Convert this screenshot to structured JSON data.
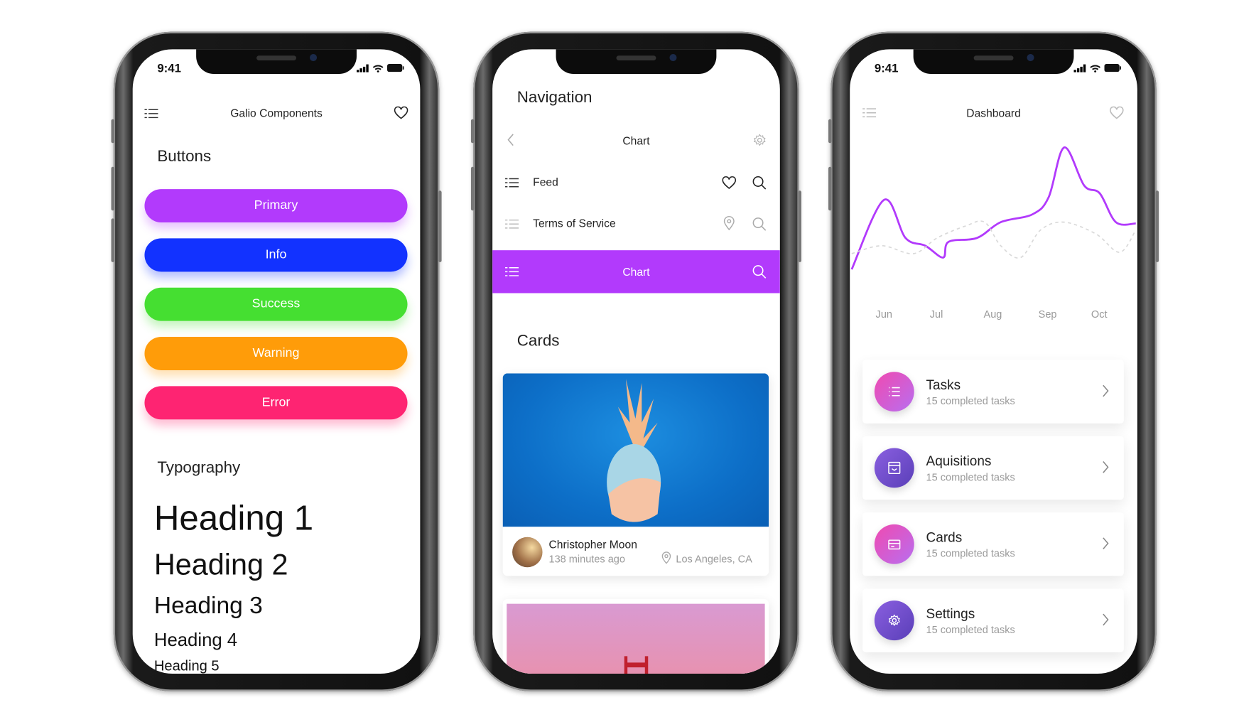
{
  "colors": {
    "primary": "#B23AFC",
    "info": "#1232FF",
    "success": "#45DF31",
    "warning": "#FF9C09",
    "error": "#FE2472",
    "chart_line": "#B23AFC",
    "chart_dash": "#D9D9D9"
  },
  "phone1": {
    "status": {
      "time": "9:41"
    },
    "header": {
      "title": "Galio Components",
      "left_icon": "menu-icon",
      "right_icon": "heart-icon"
    },
    "buttons_title": "Buttons",
    "buttons": [
      {
        "label": "Primary",
        "color": "#B23AFC"
      },
      {
        "label": "Info",
        "color": "#1232FF"
      },
      {
        "label": "Success",
        "color": "#45DF31"
      },
      {
        "label": "Warning",
        "color": "#FF9C09"
      },
      {
        "label": "Error",
        "color": "#FE2472"
      }
    ],
    "typography_title": "Typography",
    "headings": [
      "Heading 1",
      "Heading 2",
      "Heading 3",
      "Heading 4",
      "Heading 5"
    ]
  },
  "phone2": {
    "title": "Navigation",
    "navbars": [
      {
        "title": "Chart",
        "left_icon": "chevron-left-icon",
        "right_icon": "gear-icon"
      },
      {
        "title": "Feed",
        "icons": [
          "menu-icon",
          "heart-icon",
          "search-icon"
        ]
      },
      {
        "title": "Terms of Service",
        "icons": [
          "menu-icon",
          "map-pin-icon",
          "search-icon"
        ]
      },
      {
        "title": "Chart",
        "icons": [
          "menu-icon",
          "search-icon"
        ]
      }
    ],
    "cards_title": "Cards",
    "card": {
      "author": "Christopher Moon",
      "time": "138 minutes ago",
      "location": "Los Angeles, CA"
    }
  },
  "phone3": {
    "status": {
      "time": "9:41"
    },
    "header": {
      "title": "Dashboard"
    },
    "items": [
      {
        "title": "Tasks",
        "subtitle": "15 completed tasks",
        "icon": "list-icon"
      },
      {
        "title": "Aquisitions",
        "subtitle": "15 completed tasks",
        "icon": "archive-icon"
      },
      {
        "title": "Cards",
        "subtitle": "15 completed tasks",
        "icon": "credit-card-icon"
      },
      {
        "title": "Settings",
        "subtitle": "15 completed tasks",
        "icon": "gear-icon"
      }
    ]
  },
  "chart_data": {
    "type": "line",
    "categories": [
      "Jun",
      "Jul",
      "Aug",
      "Sep",
      "Oct"
    ],
    "x_unit": "month index (0=Jun)",
    "ylim": [
      0,
      100
    ],
    "grid": false,
    "series": [
      {
        "style": "solid",
        "x": [
          -0.6,
          0,
          0.4,
          0.77,
          1.1,
          1.2,
          1.73,
          2.17,
          2.76,
          3.06,
          3.35,
          3.72,
          4.01,
          4.31,
          4.68
        ],
        "values": [
          3,
          56,
          27,
          21,
          12,
          24,
          27,
          39,
          45,
          58,
          96,
          67,
          61,
          39,
          38
        ]
      },
      {
        "style": "dashed",
        "x": [
          -0.6,
          -0.04,
          0.55,
          0.99,
          1.51,
          1.87,
          2.17,
          2.54,
          2.91,
          3.35,
          3.94,
          4.38,
          4.68
        ],
        "values": [
          15,
          21,
          15,
          27,
          36,
          39,
          21,
          12,
          33,
          39,
          30,
          16,
          33
        ]
      }
    ]
  }
}
